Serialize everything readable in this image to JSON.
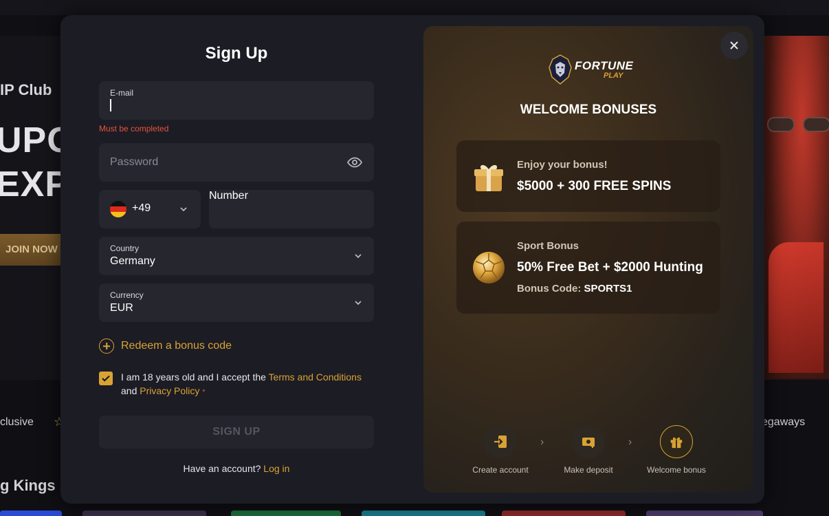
{
  "background": {
    "vip_label": "IP Club",
    "hero_line1": "UPG",
    "hero_line2": "EXPI",
    "join_button": "JOIN NOW",
    "nav_left": "clusive",
    "nav_right": "egaways",
    "section_title": "g Kings"
  },
  "signup": {
    "title": "Sign Up",
    "email": {
      "label": "E-mail",
      "value": "",
      "error": "Must be completed"
    },
    "password": {
      "placeholder": "Password"
    },
    "phone": {
      "country_code": "+49",
      "placeholder": "Number"
    },
    "country": {
      "label": "Country",
      "value": "Germany"
    },
    "currency": {
      "label": "Currency",
      "value": "EUR"
    },
    "redeem_label": "Redeem a bonus code",
    "terms": {
      "checked": true,
      "text_before": "I am 18 years old and I accept the ",
      "terms_link": "Terms and Conditions",
      "text_and": "and ",
      "privacy_link": "Privacy Policy",
      "required_mark": "*"
    },
    "submit_label": "SIGN UP",
    "have_account": "Have an account? ",
    "login_link": "Log in"
  },
  "promo": {
    "logo_word1": "FORTUNE",
    "logo_word2": "PLAY",
    "title": "WELCOME BONUSES",
    "bonus1": {
      "subtitle": "Enjoy your bonus!",
      "headline": "$5000 + 300 FREE SPINS"
    },
    "bonus2": {
      "subtitle": "Sport Bonus",
      "headline": "50% Free Bet + $2000 Hunting",
      "code_label": "Bonus Code: ",
      "code": "SPORTS1"
    },
    "steps": [
      {
        "label": "Create account"
      },
      {
        "label": "Make deposit"
      },
      {
        "label": "Welcome bonus"
      }
    ],
    "step_arrow": "›"
  },
  "colors": {
    "accent": "#d9a334",
    "error": "#e5533d",
    "modal_bg": "#1c1c24",
    "field_bg": "#26262f"
  },
  "icons": [
    "eye-icon",
    "chevron-down-icon",
    "germany-flag-icon",
    "plus-circle-icon",
    "check-icon",
    "gift-box-icon",
    "gold-ball-icon",
    "login-icon",
    "deposit-icon",
    "gift-icon",
    "close-icon"
  ]
}
